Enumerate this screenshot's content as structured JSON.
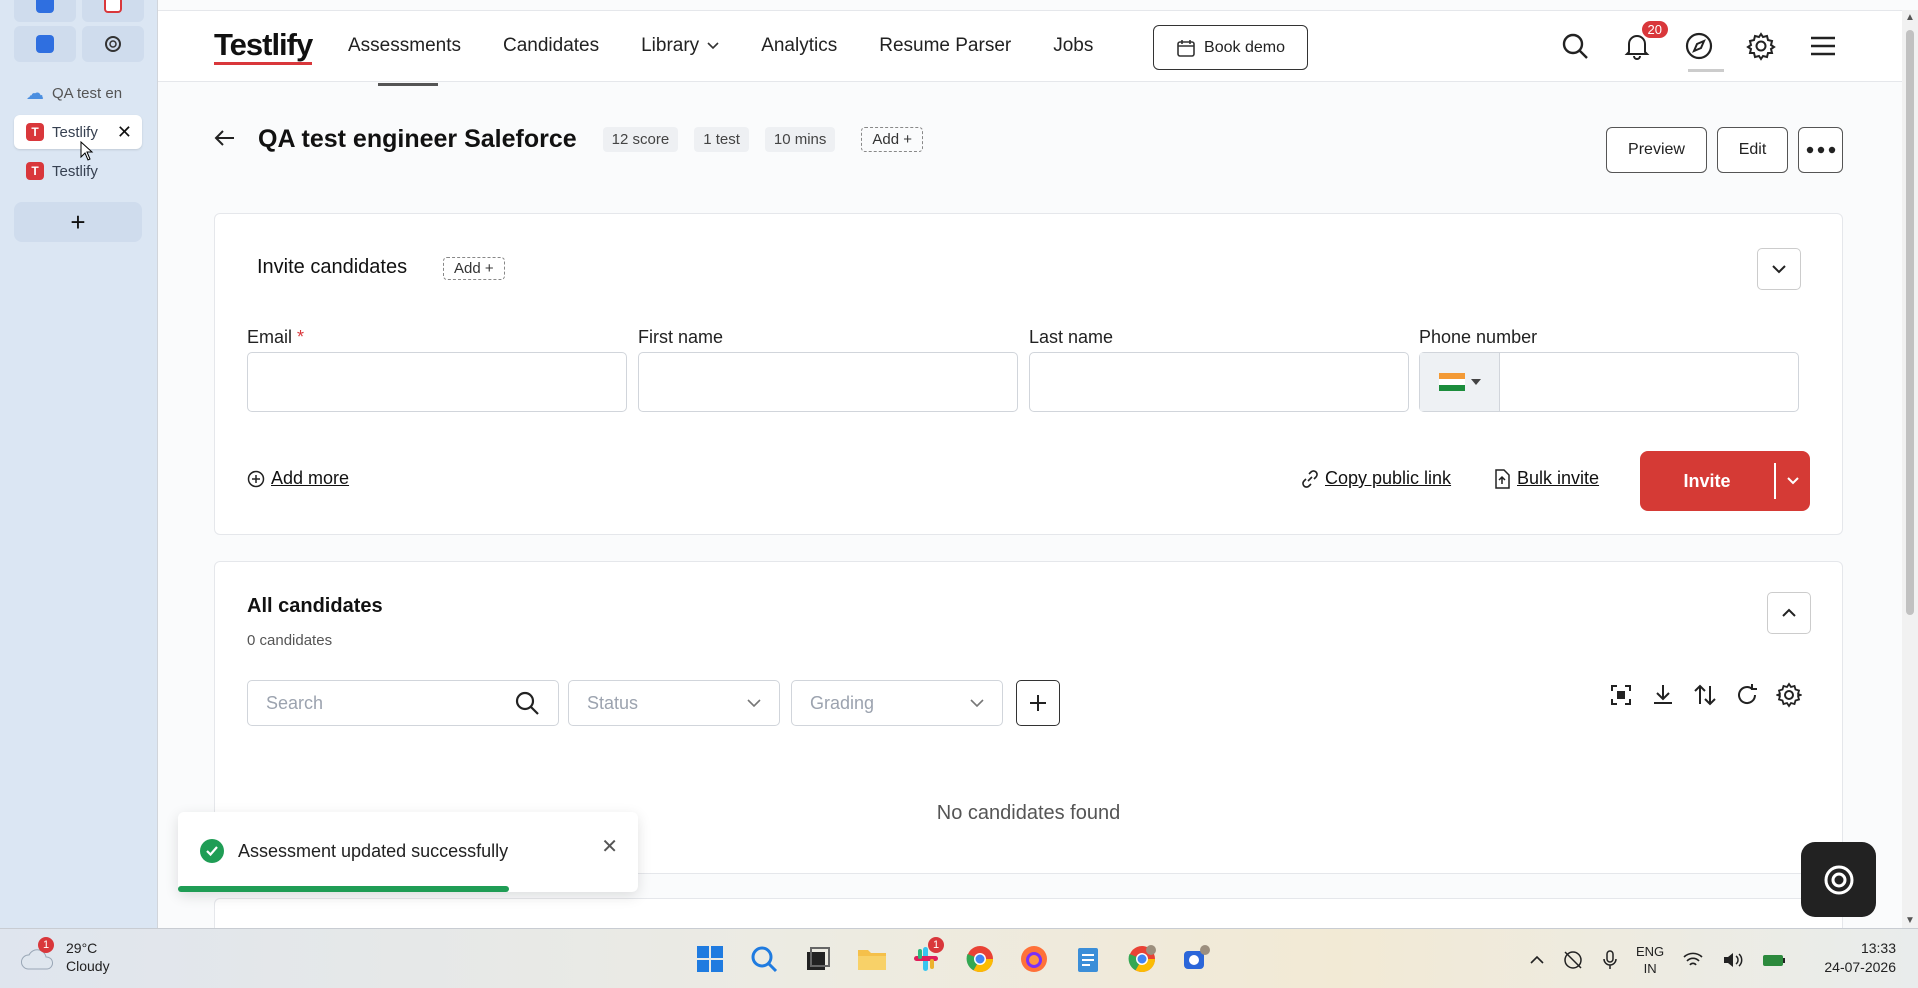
{
  "browser_tabs": {
    "items": [
      {
        "label": "QA test en",
        "type": "cloud"
      },
      {
        "label": "Testlify",
        "type": "testlify",
        "active": true
      },
      {
        "label": "Testlify",
        "type": "testlify"
      }
    ],
    "new_tab_symbol": "+"
  },
  "topbar": {
    "logo": "Testlify",
    "nav": [
      {
        "label": "Assessments"
      },
      {
        "label": "Candidates"
      },
      {
        "label": "Library"
      },
      {
        "label": "Analytics"
      },
      {
        "label": "Resume Parser"
      },
      {
        "label": "Jobs"
      }
    ],
    "book_demo": "Book demo",
    "notification_count": "20"
  },
  "assessment": {
    "title": "QA test engineer Saleforce",
    "chips": [
      "12 score",
      "1 test",
      "10 mins"
    ],
    "add_label": "Add +",
    "preview_label": "Preview",
    "edit_label": "Edit"
  },
  "invite": {
    "title": "Invite candidates",
    "add_label": "Add +",
    "fields": {
      "email": {
        "label": "Email",
        "required_mark": "*",
        "value": ""
      },
      "first_name": {
        "label": "First name",
        "value": ""
      },
      "last_name": {
        "label": "Last name",
        "value": ""
      },
      "phone": {
        "label": "Phone number",
        "value": ""
      }
    },
    "add_more": "Add more",
    "copy_public_link": "Copy public link",
    "bulk_invite": "Bulk invite",
    "invite_button": "Invite"
  },
  "candidates": {
    "title": "All candidates",
    "count_label": "0 candidates",
    "search_placeholder": "Search",
    "status_placeholder": "Status",
    "grading_placeholder": "Grading",
    "empty_message": "No candidates found"
  },
  "toast": {
    "message": "Assessment updated successfully",
    "progress": 0.72
  },
  "taskbar": {
    "weather_temp": "29°C",
    "weather_desc": "Cloudy",
    "weather_badge": "1",
    "slack_badge": "1",
    "lang_top": "ENG",
    "lang_bottom": "IN",
    "time": "13:33",
    "date": "24-07-2026"
  },
  "colors": {
    "brand_red": "#d53a35",
    "success_green": "#1f9d55"
  }
}
